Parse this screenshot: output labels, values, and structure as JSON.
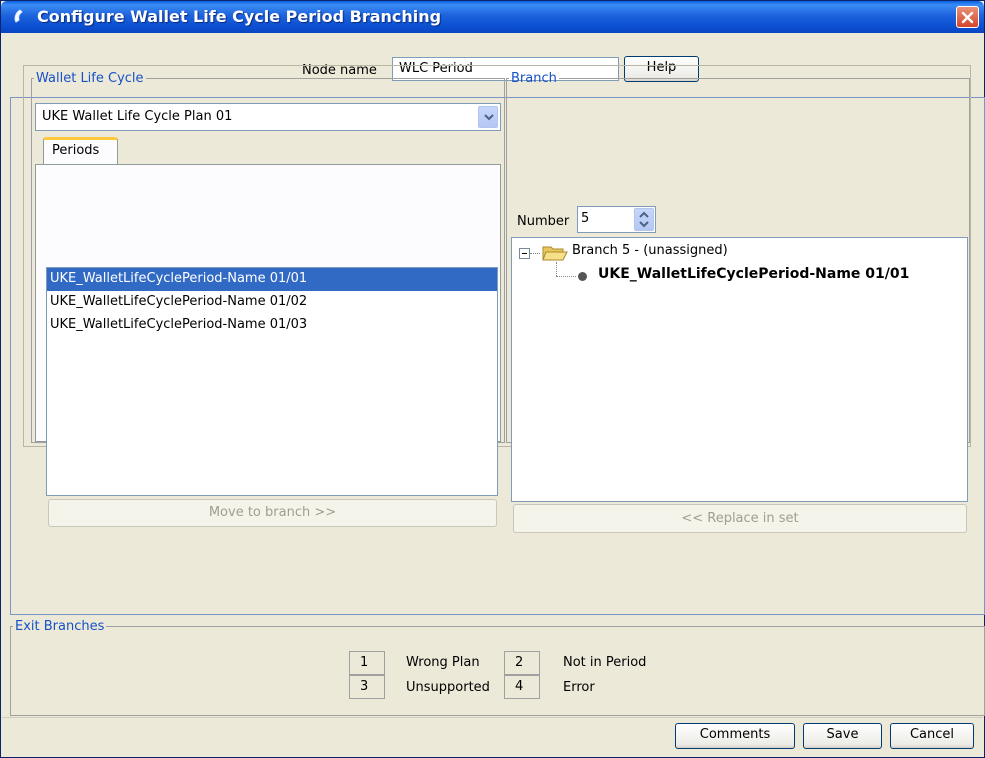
{
  "window": {
    "title": "Configure Wallet Life Cycle Period Branching"
  },
  "node": {
    "label": "Node name",
    "value": "WLC Period",
    "help_label": "Help"
  },
  "wallet_life_cycle": {
    "legend": "Wallet Life Cycle",
    "plan_selected": "UKE Wallet Life Cycle Plan 01",
    "tab_label": "Periods",
    "periods": [
      {
        "label": "UKE_WalletLifeCyclePeriod-Name 01/01",
        "selected": true
      },
      {
        "label": "UKE_WalletLifeCyclePeriod-Name 01/02",
        "selected": false
      },
      {
        "label": "UKE_WalletLifeCyclePeriod-Name 01/03",
        "selected": false
      }
    ],
    "move_button": "Move to branch >>"
  },
  "branch": {
    "legend": "Branch",
    "number_label": "Number",
    "number_value": "5",
    "tree_root": "Branch 5 - (unassigned)",
    "tree_leaf": "UKE_WalletLifeCyclePeriod-Name 01/01",
    "replace_button": "<< Replace in set"
  },
  "exit_branches": {
    "legend": "Exit Branches",
    "items": [
      {
        "num": "1",
        "label": "Wrong Plan"
      },
      {
        "num": "2",
        "label": "Not in Period"
      },
      {
        "num": "3",
        "label": "Unsupported"
      },
      {
        "num": "4",
        "label": "Error"
      }
    ]
  },
  "footer": {
    "comments": "Comments",
    "save": "Save",
    "cancel": "Cancel"
  },
  "colors": {
    "title_bar": "#0b4fd1",
    "selection": "#316ac5",
    "legend": "#1651c8",
    "tab_highlight": "#ffc83c"
  }
}
